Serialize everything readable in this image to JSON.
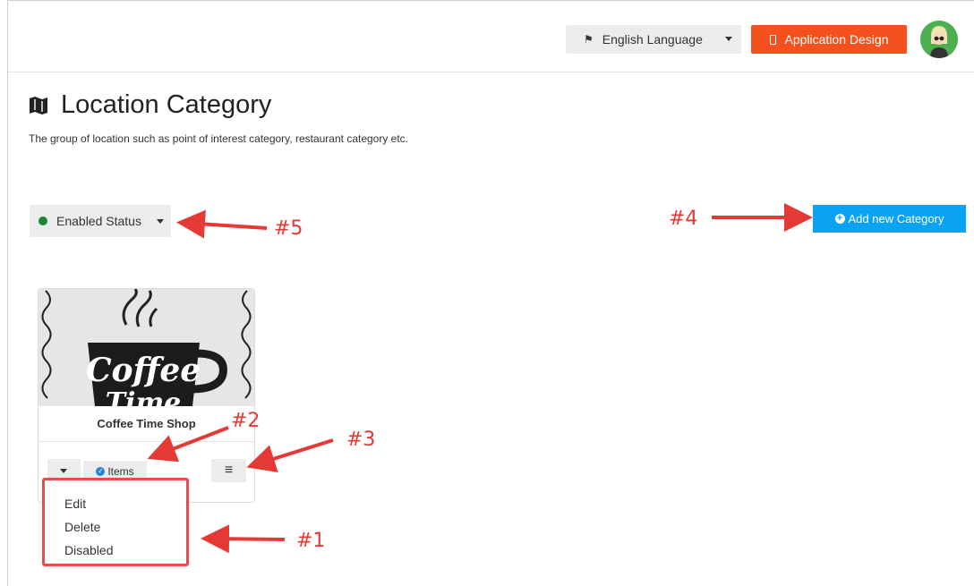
{
  "header": {
    "language_label": "English Language",
    "app_design_label": "Application Design"
  },
  "page": {
    "title": "Location Category",
    "description": "The group of location such as point of interest category, restaurant category etc."
  },
  "toolbar": {
    "status_label": "Enabled Status",
    "add_category_label": "Add new Category"
  },
  "card": {
    "title": "Coffee Time Shop",
    "items_label": "Items",
    "image_text": [
      "Coffee",
      "Time"
    ]
  },
  "dropdown": {
    "items": [
      "Edit",
      "Delete",
      "Disabled"
    ]
  },
  "annotations": {
    "one": "#1",
    "two": "#2",
    "three": "#3",
    "four": "#4",
    "five": "#5"
  },
  "colors": {
    "accent_orange": "#f4511e",
    "accent_blue": "#0aa3f3",
    "status_green": "#1b8a2f",
    "annotation_red": "#e53935"
  },
  "icons": {
    "flag": "flag-icon",
    "phone": "phone-icon",
    "map": "map-icon",
    "plus": "plus-circle-icon",
    "check": "check-circle-icon",
    "menu": "hamburger-icon"
  }
}
